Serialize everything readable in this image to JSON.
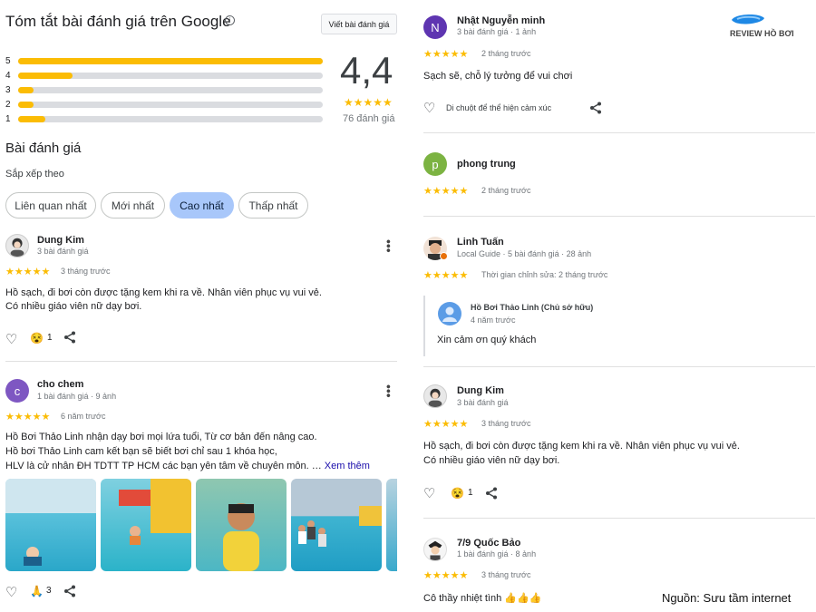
{
  "summary": {
    "title": "Tóm tắt bài đánh giá trên Google",
    "write_review": "Viết bài đánh giá",
    "rating": "4,4",
    "count": "76 đánh giá",
    "stars": "★★★★★",
    "bars": [
      {
        "label": "5",
        "fill": 1.0
      },
      {
        "label": "4",
        "fill": 0.18
      },
      {
        "label": "3",
        "fill": 0.05
      },
      {
        "label": "2",
        "fill": 0.05
      },
      {
        "label": "1",
        "fill": 0.09
      }
    ]
  },
  "reviews_heading": "Bài đánh giá",
  "sort_label": "Sắp xếp theo",
  "sort_options": [
    "Liên quan nhất",
    "Mới nhất",
    "Cao nhất",
    "Thấp nhất"
  ],
  "selected_sort": "Cao nhất",
  "left_reviews": [
    {
      "name": "Dung Kim",
      "meta": "3 bài đánh giá",
      "stars": "★★★★★",
      "time": "3 tháng trước",
      "text1": "Hồ sạch, đi bơi còn được tặng kem khi ra về. Nhân viên phục vụ vui vẻ.",
      "text2": "Có nhiều giáo viên nữ dạy bơi.",
      "reaction": "1"
    },
    {
      "name": "cho chem",
      "initial": "c",
      "meta": "1 bài đánh giá · 9 ảnh",
      "stars": "★★★★★",
      "time": "6 năm trước",
      "text1": "Hồ Bơi Thảo Linh nhận dạy bơi mọi lứa tuổi, Từ cơ bản đến nâng cao.",
      "text2": "Hồ bơi Thảo Linh cam kết bạn sẽ biết bơi chỉ sau 1 khóa học,",
      "text3": "HLV là cử nhân ĐH TDTT TP HCM các bạn yên tâm về chuyên môn. …",
      "more": "Xem thêm",
      "reaction": "3"
    }
  ],
  "right_reviews": [
    {
      "name": "Nhật Nguyễn minh",
      "initial": "N",
      "meta": "3 bài đánh giá · 1 ảnh",
      "stars": "★★★★★",
      "time": "2 tháng trước",
      "text1": "Sạch sẽ, chỗ lý tưởng để vui chơi",
      "hover_hint": "Di chuột để thể hiện cảm xúc"
    },
    {
      "name": "phong trung",
      "initial": "p",
      "stars": "★★★★★",
      "time": "2 tháng trước"
    },
    {
      "name": "Linh Tuấn",
      "meta": "Local Guide · 5 bài đánh giá · 28 ảnh",
      "stars": "★★★★★",
      "time": "Thời gian chỉnh sửa: 2 tháng trước",
      "owner_name": "Hồ Bơi Thảo Linh (Chủ sở hữu)",
      "owner_time": "4 năm trước",
      "owner_reply": "Xin cảm ơn quý khách"
    },
    {
      "name": "Dung Kim",
      "meta": "3 bài đánh giá",
      "stars": "★★★★★",
      "time": "3 tháng trước",
      "text1": "Hồ sạch, đi bơi còn được tặng kem khi ra về. Nhân viên phục vụ vui vẻ.",
      "text2": "Có nhiều giáo viên nữ dạy bơi.",
      "reaction": "1"
    },
    {
      "name": "7/9 Quốc Bảo",
      "meta": "1 bài đánh giá · 8 ảnh",
      "stars": "★★★★★",
      "time": "3 tháng trước",
      "text1": "Cô thầy nhiệt tình 👍👍👍"
    }
  ],
  "logo_text": "REVIEW HỒ BƠI",
  "source": "Nguồn: Sưu tầm internet",
  "colors": {
    "accent": "#fbbc04",
    "selected_pill": "#a8c7fa",
    "avatar_purple": "#7e57c2",
    "avatar_green": "#7cb342",
    "avatar_indigo": "#5e35b1"
  }
}
